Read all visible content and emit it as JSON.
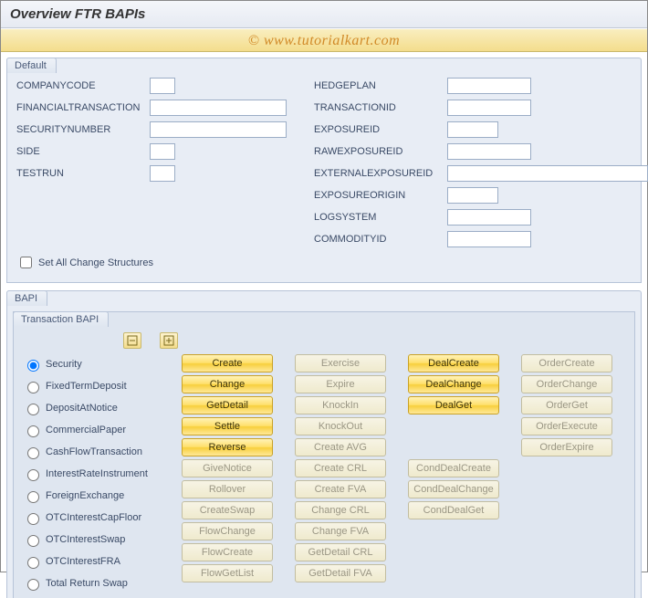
{
  "title": "Overview FTR BAPIs",
  "watermark": "© www.tutorialkart.com",
  "default_box": {
    "title": "Default",
    "left": [
      {
        "label": "COMPANYCODE",
        "cls": "w-xs"
      },
      {
        "label": "FINANCIALTRANSACTION",
        "cls": "w-l"
      },
      {
        "label": "SECURITYNUMBER",
        "cls": "w-l"
      },
      {
        "label": "SIDE",
        "cls": "w-xs"
      },
      {
        "label": "TESTRUN",
        "cls": "w-xs"
      }
    ],
    "right": [
      {
        "label": "HEDGEPLAN",
        "cls": "w-m"
      },
      {
        "label": "TRANSACTIONID",
        "cls": "w-m"
      },
      {
        "label": "EXPOSUREID",
        "cls": "w-s"
      },
      {
        "label": "RAWEXPOSUREID",
        "cls": "w-m"
      },
      {
        "label": "EXTERNALEXPOSUREID",
        "cls": "w-xl"
      },
      {
        "label": "EXPOSUREORIGIN",
        "cls": "w-s"
      },
      {
        "label": "LOGSYSTEM",
        "cls": "w-m"
      },
      {
        "label": "COMMODITYID",
        "cls": "w-m"
      }
    ],
    "checkbox_label": "Set All Change Structures"
  },
  "bapi_box": {
    "title": "BAPI",
    "sub_title": "Transaction BAPI",
    "radios": [
      "Security",
      "FixedTermDeposit",
      "DepositAtNotice",
      "CommercialPaper",
      "CashFlowTransaction",
      "InterestRateInstrument",
      "ForeignExchange",
      "OTCInterestCapFloor",
      "OTCInterestSwap",
      "OTCInterestFRA",
      "Total Return Swap"
    ],
    "selected_radio": 0,
    "btn_cols": [
      [
        {
          "t": "Create",
          "a": true
        },
        {
          "t": "Change",
          "a": true
        },
        {
          "t": "GetDetail",
          "a": true
        },
        {
          "t": "Settle",
          "a": true
        },
        {
          "t": "Reverse",
          "a": true
        },
        {
          "t": "GiveNotice",
          "a": false
        },
        {
          "t": "Rollover",
          "a": false
        },
        {
          "t": "CreateSwap",
          "a": false
        },
        {
          "t": "FlowChange",
          "a": false
        },
        {
          "t": "FlowCreate",
          "a": false
        },
        {
          "t": "FlowGetList",
          "a": false
        }
      ],
      [
        {
          "t": "Exercise",
          "a": false
        },
        {
          "t": "Expire",
          "a": false
        },
        {
          "t": "KnockIn",
          "a": false
        },
        {
          "t": "KnockOut",
          "a": false
        },
        {
          "t": "Create AVG",
          "a": false
        },
        {
          "t": "Create CRL",
          "a": false
        },
        {
          "t": "Create FVA",
          "a": false
        },
        {
          "t": "Change CRL",
          "a": false
        },
        {
          "t": "Change FVA",
          "a": false
        },
        {
          "t": "GetDetail CRL",
          "a": false
        },
        {
          "t": "GetDetail FVA",
          "a": false
        }
      ],
      [
        {
          "t": "DealCreate",
          "a": true
        },
        {
          "t": "DealChange",
          "a": true
        },
        {
          "t": "DealGet",
          "a": true
        },
        null,
        null,
        {
          "t": "CondDealCreate",
          "a": false
        },
        {
          "t": "CondDealChange",
          "a": false
        },
        {
          "t": "CondDealGet",
          "a": false
        }
      ],
      [
        {
          "t": "OrderCreate",
          "a": false
        },
        {
          "t": "OrderChange",
          "a": false
        },
        {
          "t": "OrderGet",
          "a": false
        },
        {
          "t": "OrderExecute",
          "a": false
        },
        {
          "t": "OrderExpire",
          "a": false
        }
      ]
    ]
  }
}
